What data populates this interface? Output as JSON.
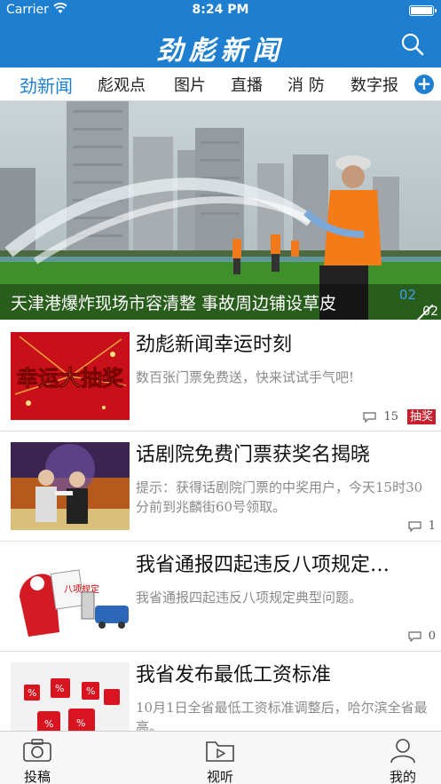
{
  "status_bar": {
    "carrier": "Carrier",
    "time": "8:24 PM"
  },
  "header": {
    "brand": "劲彪新闻",
    "icons": {
      "search": "search-icon"
    }
  },
  "tabs": [
    {
      "label": "劲新闻",
      "active": true
    },
    {
      "label": "彪观点"
    },
    {
      "label": "图片"
    },
    {
      "label": "直播"
    },
    {
      "label": "消 防"
    },
    {
      "label": "数字报"
    }
  ],
  "banner": {
    "caption": "天津港爆炸现场市容清整 事故周边铺设草皮",
    "page_current": "02",
    "page_total": "02"
  },
  "news": [
    {
      "title": "劲彪新闻幸运时刻",
      "desc": "数百张门票免费送，快来试试手气吧!",
      "comments": "15",
      "badge": "抽奖",
      "thumb_text": "幸运大抽奖"
    },
    {
      "title": "话剧院免费门票获奖名揭晓",
      "desc": "提示：获得话剧院门票的中奖用户，今天15时30分前到兆麟街60号领取。",
      "comments": "1"
    },
    {
      "title": "我省通报四起违反八项规定…",
      "desc": "我省通报四起违反八项规定典型问题。",
      "comments": "0",
      "thumb_text": "八项规定"
    },
    {
      "title": "我省发布最低工资标准",
      "desc": "10月1日全省最低工资标准调整后，哈尔滨全省最高。"
    }
  ],
  "bottom_tabs": [
    {
      "label": "投稿",
      "icon": "camera-icon"
    },
    {
      "label": "视听",
      "icon": "video-folder-icon"
    },
    {
      "label": "我的",
      "icon": "user-icon"
    }
  ],
  "colors": {
    "brand_blue": "#1e7fd0",
    "badge_red": "#c71f2d"
  }
}
